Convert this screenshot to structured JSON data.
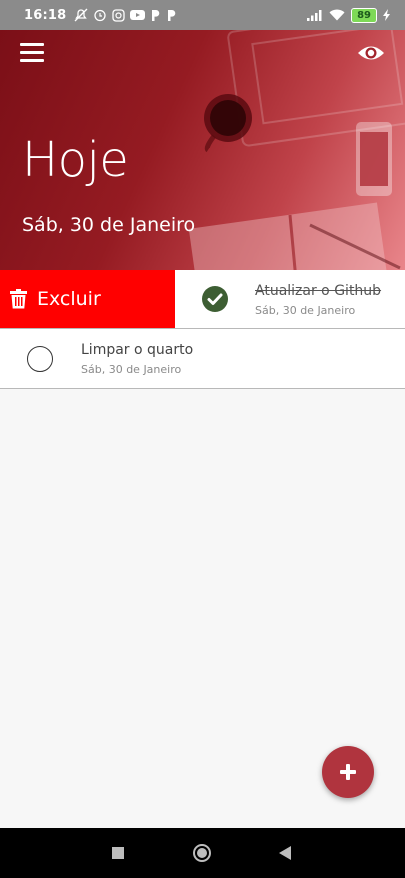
{
  "status_bar": {
    "time": "16:18",
    "battery": "89",
    "icons": [
      "mute-icon",
      "alarm-icon",
      "instagram-icon",
      "youtube-icon",
      "p-icon",
      "p-icon",
      "signal-icon",
      "wifi-icon",
      "battery-icon",
      "charging-icon"
    ]
  },
  "header": {
    "title": "Hoje",
    "date": "Sáb, 30 de Janeiro",
    "menu_icon": "hamburger-icon",
    "visibility_icon": "eye-icon"
  },
  "tasks": [
    {
      "title": "Atualizar o Github",
      "date": "Sáb, 30 de Janeiro",
      "done": true,
      "swipe_action": "Excluir"
    },
    {
      "title": "Limpar o quarto",
      "date": "Sáb, 30 de Janeiro",
      "done": false
    }
  ],
  "fab": {
    "icon": "plus-icon"
  },
  "colors": {
    "header_dark": "#7b0f17",
    "delete_red": "#ff0000",
    "done_green": "#3d5e33",
    "fab": "#b0343e"
  }
}
